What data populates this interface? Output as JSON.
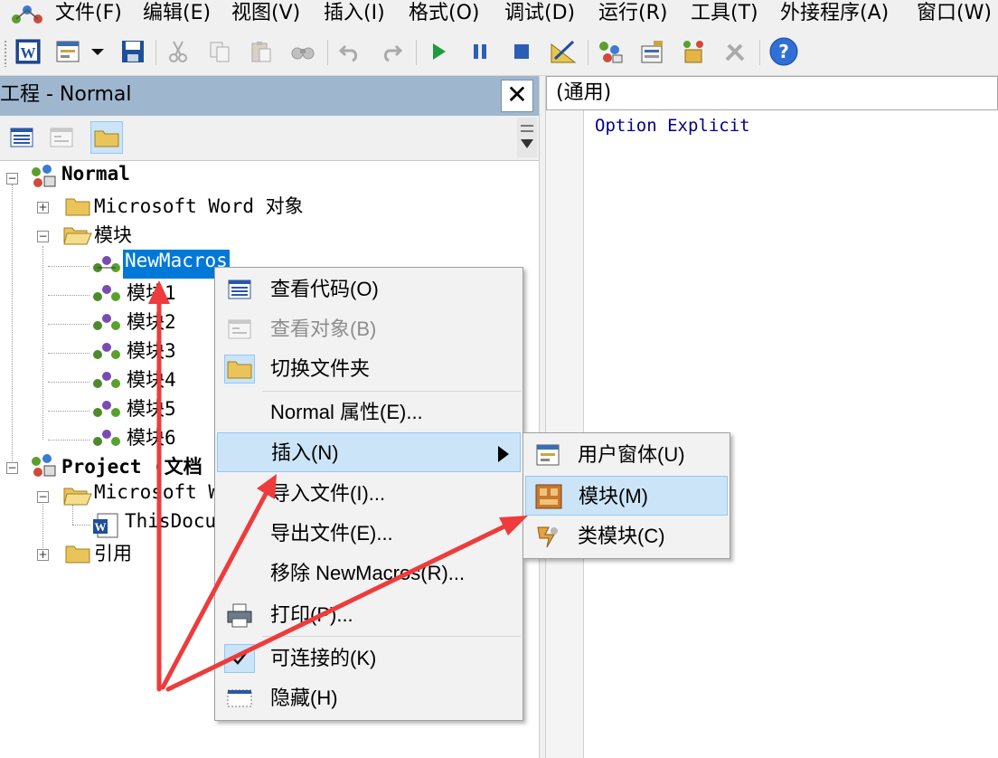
{
  "menubar": {
    "items": [
      "文件(F)",
      "编辑(E)",
      "视图(V)",
      "插入(I)",
      "格式(O)",
      "调试(D)",
      "运行(R)",
      "工具(T)",
      "外接程序(A)",
      "窗口(W)"
    ]
  },
  "toolbar": {
    "icons": [
      "word-icon",
      "userform-icon",
      "dropdown-arrow-icon",
      "save-icon",
      "cut-icon",
      "copy-icon",
      "paste-icon",
      "find-icon",
      "undo-icon",
      "redo-icon",
      "run-icon",
      "break-icon",
      "reset-icon",
      "design-mode-icon",
      "project-explorer-icon",
      "properties-icon",
      "object-browser-icon",
      "toolbox-icon",
      "help-icon"
    ]
  },
  "project_pane": {
    "title": "工程 - Normal",
    "close_glyph": "✕",
    "tree": {
      "normal": "Normal",
      "word_objects": "Microsoft Word 对象",
      "modules_folder": "模块",
      "modules": [
        "NewMacros",
        "模块1",
        "模块2",
        "模块3",
        "模块4",
        "模块5",
        "模块6"
      ],
      "project": "Project (文档",
      "project_word_objects": "Microsoft W",
      "this_document": "ThisDocu",
      "references": "引用"
    }
  },
  "code_pane": {
    "object_combo": "(通用)",
    "code_text": "Option Explicit"
  },
  "context_menu": {
    "items": [
      {
        "label": "查看代码(O)",
        "icon": "view-code-icon"
      },
      {
        "label": "查看对象(B)",
        "icon": "view-object-icon",
        "disabled": true
      },
      {
        "label": "切换文件夹",
        "icon": "folder-icon"
      },
      {
        "label": "Normal 属性(E)..."
      },
      {
        "label": "插入(N)",
        "has_submenu": true
      },
      {
        "label": "导入文件(I)..."
      },
      {
        "label": "导出文件(E)..."
      },
      {
        "label": "移除 NewMacros(R)..."
      },
      {
        "label": "打印(P)...",
        "icon": "print-icon"
      },
      {
        "label": "可连接的(K)",
        "icon": "check-icon"
      },
      {
        "label": "隐藏(H)",
        "icon": "hide-window-icon"
      }
    ]
  },
  "submenu": {
    "items": [
      {
        "label": "用户窗体(U)",
        "icon": "userform-icon"
      },
      {
        "label": "模块(M)",
        "icon": "module-icon"
      },
      {
        "label": "类模块(C)",
        "icon": "class-module-icon"
      }
    ]
  },
  "annotation_color": "#ee3b3b"
}
